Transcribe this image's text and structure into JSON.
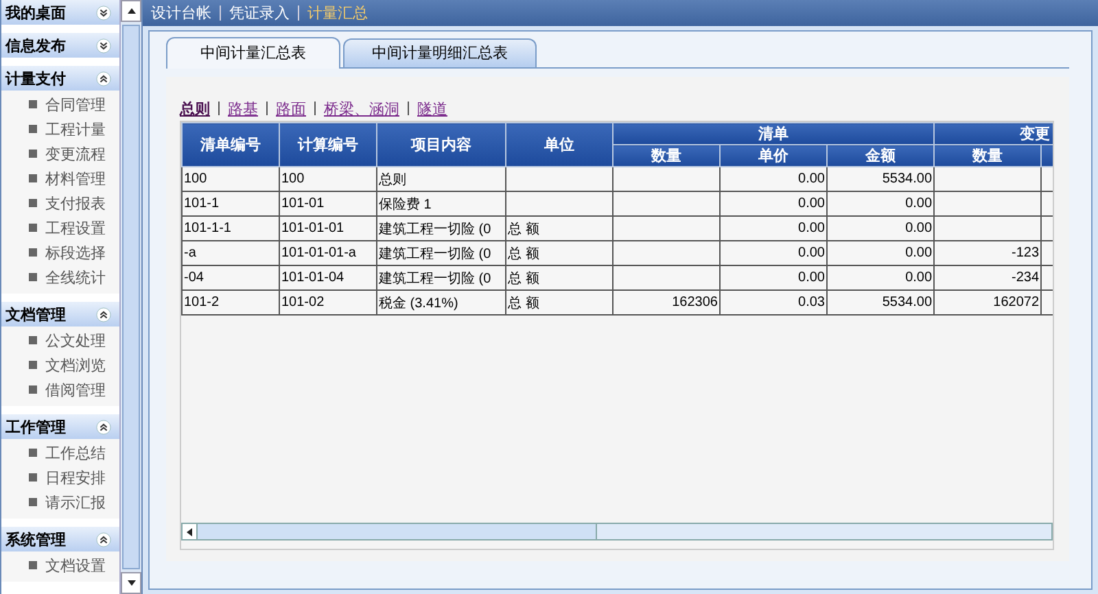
{
  "sidebar": {
    "groups": [
      {
        "title": "我的桌面",
        "expanded": false
      },
      {
        "title": "信息发布",
        "expanded": false
      },
      {
        "title": "计量支付",
        "expanded": true,
        "items": [
          "合同管理",
          "工程计量",
          "变更流程",
          "材料管理",
          "支付报表",
          "工程设置",
          "标段选择",
          "全线统计"
        ]
      },
      {
        "title": "文档管理",
        "expanded": true,
        "items": [
          "公文处理",
          "文档浏览",
          "借阅管理"
        ]
      },
      {
        "title": "工作管理",
        "expanded": true,
        "items": [
          "工作总结",
          "日程安排",
          "请示汇报"
        ]
      },
      {
        "title": "系统管理",
        "expanded": true,
        "items": [
          "文档设置"
        ]
      }
    ]
  },
  "nav": [
    {
      "label": "设计台帐",
      "selected": false
    },
    {
      "label": "凭证录入",
      "selected": false
    },
    {
      "label": "计量汇总",
      "selected": true
    }
  ],
  "tabs": [
    {
      "label": "中间计量汇总表",
      "selected": true
    },
    {
      "label": "中间计量明细汇总表",
      "selected": false
    }
  ],
  "links": [
    {
      "label": "总则",
      "selected": true
    },
    {
      "label": "路基",
      "selected": false
    },
    {
      "label": "路面",
      "selected": false
    },
    {
      "label": "桥梁、涵洞",
      "selected": false
    },
    {
      "label": "隧道",
      "selected": false
    }
  ],
  "table": {
    "columns": [
      "清单编号",
      "计算编号",
      "项目内容",
      "单位"
    ],
    "groups": [
      {
        "label": "清单",
        "columns": [
          "数量",
          "单价",
          "金额"
        ]
      },
      {
        "label": "变更",
        "columns": [
          "数量"
        ]
      }
    ],
    "rows": [
      [
        "100",
        "100",
        "总则",
        null,
        null,
        "0.00",
        "5534.00",
        null
      ],
      [
        "101-1",
        "101-01",
        "保险费 1",
        null,
        null,
        "0.00",
        "0.00",
        null
      ],
      [
        "101-1-1",
        "101-01-01",
        "建筑工程一切险 (0",
        "总 额",
        null,
        "0.00",
        "0.00",
        null
      ],
      [
        "-a",
        "101-01-01-a",
        "建筑工程一切险 (0",
        "总 额",
        null,
        "0.00",
        "0.00",
        "-123"
      ],
      [
        "-04",
        "101-01-04",
        "建筑工程一切险 (0",
        "总 额",
        null,
        "0.00",
        "0.00",
        "-234"
      ],
      [
        "101-2",
        "101-02",
        "税金 (3.41%)",
        "总 额",
        "162306",
        "0.03",
        "5534.00",
        "162072"
      ]
    ]
  }
}
